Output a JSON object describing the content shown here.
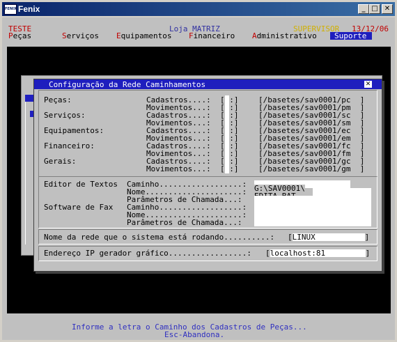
{
  "window": {
    "title": "Fenix",
    "icon_text": "FENIX",
    "min": "_",
    "max": "□",
    "close": "✕"
  },
  "header": {
    "left": "TESTE",
    "center": "Loja MATRIZ",
    "user": "SUPERVISOR",
    "date": "13/12/06"
  },
  "menu": [
    {
      "label": "Peças",
      "hot": "P",
      "rest": "eças"
    },
    {
      "label": "Serviços",
      "hot": "S",
      "rest": "erviços"
    },
    {
      "label": "Equipamentos",
      "hot": "E",
      "rest": "quipamentos"
    },
    {
      "label": "Financeiro",
      "hot": "F",
      "rest": "inanceiro"
    },
    {
      "label": "Administrativo",
      "hot": "A",
      "rest": "dministrativo"
    },
    {
      "label": "Suporte",
      "hot": "",
      "rest": "Suporte"
    }
  ],
  "dialog": {
    "title": "Configuração da Rede Caminhamentos",
    "close": "✕",
    "groups": [
      {
        "name": "Peças:",
        "rows": [
          {
            "label": "Cadastros....:",
            "drive": ":",
            "path": "/basetes/sav0001/pc"
          },
          {
            "label": "Movimentos...:",
            "drive": ":",
            "path": "/basetes/sav0001/pm"
          }
        ]
      },
      {
        "name": "Serviços:",
        "rows": [
          {
            "label": "Cadastros....:",
            "drive": ":",
            "path": "/basetes/sav0001/sc"
          },
          {
            "label": "Movimentos...:",
            "drive": ":",
            "path": "/basetes/sav0001/sm"
          }
        ]
      },
      {
        "name": "Equipamentos:",
        "rows": [
          {
            "label": "Cadastros....:",
            "drive": ":",
            "path": "/basetes/sav0001/ec"
          },
          {
            "label": "Movimentos...:",
            "drive": ":",
            "path": "/basetes/sav0001/em"
          }
        ]
      },
      {
        "name": "Financeiro:",
        "rows": [
          {
            "label": "Cadastros....:",
            "drive": ":",
            "path": "/basetes/sav0001/fc"
          },
          {
            "label": "Movimentos...:",
            "drive": ":",
            "path": "/basetes/sav0001/fm"
          }
        ]
      },
      {
        "name": "Gerais:",
        "rows": [
          {
            "label": "Cadastros....:",
            "drive": ":",
            "path": "/basetes/sav0001/gc"
          },
          {
            "label": "Movimentos...:",
            "drive": ":",
            "path": "/basetes/sav0001/gm"
          }
        ]
      }
    ],
    "editor": {
      "heading": "Editor de Textos",
      "caminho_label": "Caminho..................:",
      "caminho_value": "G:\\SAV0001\\",
      "nome_label": "Nome.....................:",
      "nome_value": "EDITA.BAT",
      "param_label": "Parâmetros de Chamada...:",
      "param_value": ""
    },
    "fax": {
      "heading": "Software de Fax",
      "caminho_label": "Caminho..................:",
      "caminho_value": "",
      "nome_label": "Nome.....................:",
      "nome_value": "",
      "param_label": "Parâmetros de Chamada...:",
      "param_value": ""
    },
    "network": {
      "label": "Nome da rede que o sistema está rodando..........:",
      "value": "LINUX"
    },
    "ip": {
      "label": "Endereço IP gerador gráfico.................:",
      "value": "localhost:81"
    }
  },
  "status": {
    "line1": "Informe a letra o Caminho dos Cadastros de Peças...",
    "line2": "Esc-Abandona."
  }
}
